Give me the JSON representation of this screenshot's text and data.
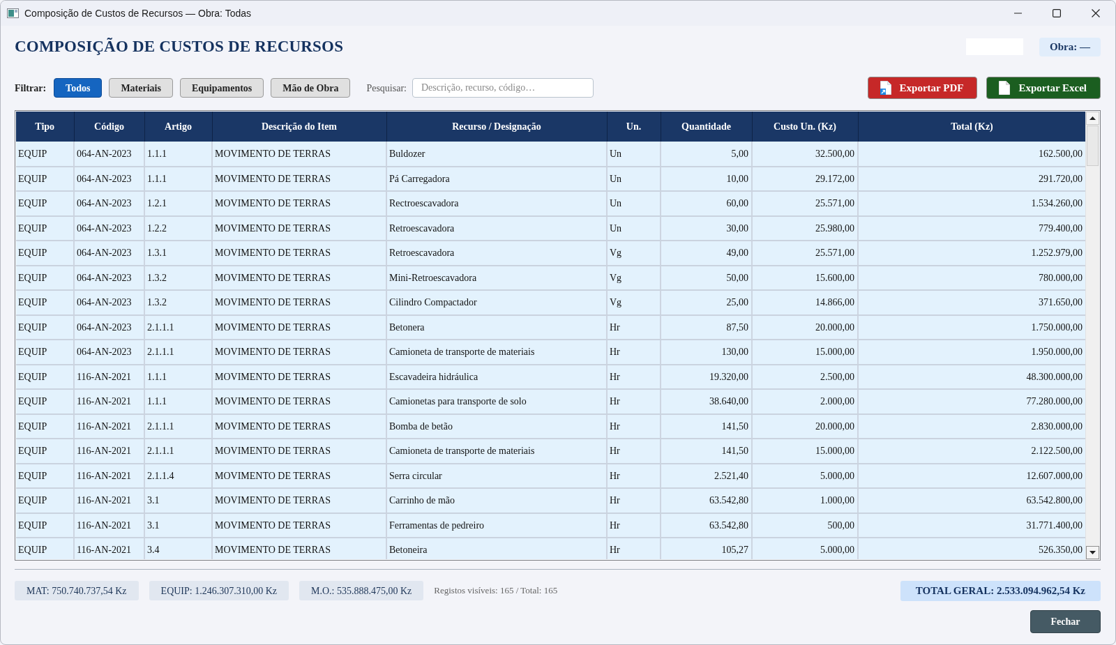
{
  "window": {
    "title": "Composição de Custos de Recursos — Obra: Todas"
  },
  "header": {
    "title": "COMPOSIÇÃO DE CUSTOS DE RECURSOS",
    "obra_label": "Obra: —"
  },
  "filter": {
    "label": "Filtrar:",
    "options": [
      {
        "label": "Todos",
        "selected": true
      },
      {
        "label": "Materiais",
        "selected": false
      },
      {
        "label": "Equipamentos",
        "selected": false
      },
      {
        "label": "Mão de Obra",
        "selected": false
      }
    ],
    "search": {
      "label": "Pesquisar:",
      "placeholder": "Descrição, recurso, código…"
    }
  },
  "export_buttons": [
    {
      "label": "Exportar PDF",
      "kind": "pdf"
    },
    {
      "label": "Exportar Excel",
      "kind": "excel"
    }
  ],
  "table": {
    "columns": [
      {
        "label": "Tipo",
        "kind": "text"
      },
      {
        "label": "Código",
        "kind": "text"
      },
      {
        "label": "Artigo",
        "kind": "text"
      },
      {
        "label": "Descrição do Item",
        "kind": "text"
      },
      {
        "label": "Recurso / Designação",
        "kind": "text"
      },
      {
        "label": "Un.",
        "kind": "text"
      },
      {
        "label": "Quantidade",
        "kind": "number"
      },
      {
        "label": "Custo Un. (Kz)",
        "kind": "number"
      },
      {
        "label": "Total (Kz)",
        "kind": "number"
      }
    ],
    "rows": [
      [
        "EQUIP",
        "064-AN-2023",
        "1.1.1",
        "MOVIMENTO DE TERRAS",
        "Buldozer",
        "Un",
        "5,00",
        "32.500,00",
        "162.500,00"
      ],
      [
        "EQUIP",
        "064-AN-2023",
        "1.1.1",
        "MOVIMENTO DE TERRAS",
        "Pá Carregadora",
        "Un",
        "10,00",
        "29.172,00",
        "291.720,00"
      ],
      [
        "EQUIP",
        "064-AN-2023",
        "1.2.1",
        "MOVIMENTO DE TERRAS",
        "Rectroescavadora",
        "Un",
        "60,00",
        "25.571,00",
        "1.534.260,00"
      ],
      [
        "EQUIP",
        "064-AN-2023",
        "1.2.2",
        "MOVIMENTO DE TERRAS",
        "Retroescavadora",
        "Un",
        "30,00",
        "25.980,00",
        "779.400,00"
      ],
      [
        "EQUIP",
        "064-AN-2023",
        "1.3.1",
        "MOVIMENTO DE TERRAS",
        "Retroescavadora",
        "Vg",
        "49,00",
        "25.571,00",
        "1.252.979,00"
      ],
      [
        "EQUIP",
        "064-AN-2023",
        "1.3.2",
        "MOVIMENTO DE TERRAS",
        "Mini-Retroescavadora",
        "Vg",
        "50,00",
        "15.600,00",
        "780.000,00"
      ],
      [
        "EQUIP",
        "064-AN-2023",
        "1.3.2",
        "MOVIMENTO DE TERRAS",
        "Cilindro Compactador",
        "Vg",
        "25,00",
        "14.866,00",
        "371.650,00"
      ],
      [
        "EQUIP",
        "064-AN-2023",
        "2.1.1.1",
        "MOVIMENTO DE TERRAS",
        "Betonera",
        "Hr",
        "87,50",
        "20.000,00",
        "1.750.000,00"
      ],
      [
        "EQUIP",
        "064-AN-2023",
        "2.1.1.1",
        "MOVIMENTO DE TERRAS",
        "Camioneta de transporte de materiais",
        "Hr",
        "130,00",
        "15.000,00",
        "1.950.000,00"
      ],
      [
        "EQUIP",
        "116-AN-2021",
        "1.1.1",
        "MOVIMENTO DE TERRAS",
        "Escavadeira hidráulica",
        "Hr",
        "19.320,00",
        "2.500,00",
        "48.300.000,00"
      ],
      [
        "EQUIP",
        "116-AN-2021",
        "1.1.1",
        "MOVIMENTO DE TERRAS",
        "Camionetas para transporte de solo",
        "Hr",
        "38.640,00",
        "2.000,00",
        "77.280.000,00"
      ],
      [
        "EQUIP",
        "116-AN-2021",
        "2.1.1.1",
        "MOVIMENTO DE TERRAS",
        "Bomba de betão",
        "Hr",
        "141,50",
        "20.000,00",
        "2.830.000,00"
      ],
      [
        "EQUIP",
        "116-AN-2021",
        "2.1.1.1",
        "MOVIMENTO DE TERRAS",
        "Camioneta de transporte de materiais",
        "Hr",
        "141,50",
        "15.000,00",
        "2.122.500,00"
      ],
      [
        "EQUIP",
        "116-AN-2021",
        "2.1.1.4",
        "MOVIMENTO DE TERRAS",
        "Serra circular",
        "Hr",
        "2.521,40",
        "5.000,00",
        "12.607.000,00"
      ],
      [
        "EQUIP",
        "116-AN-2021",
        "3.1",
        "MOVIMENTO DE TERRAS",
        "Carrinho de mão",
        "Hr",
        "63.542,80",
        "1.000,00",
        "63.542.800,00"
      ],
      [
        "EQUIP",
        "116-AN-2021",
        "3.1",
        "MOVIMENTO DE TERRAS",
        "Ferramentas de pedreiro",
        "Hr",
        "63.542,80",
        "500,00",
        "31.771.400,00"
      ],
      [
        "EQUIP",
        "116-AN-2021",
        "3.4",
        "MOVIMENTO DE TERRAS",
        "Betoneira",
        "Hr",
        "105,27",
        "5.000,00",
        "526.350,00"
      ]
    ]
  },
  "summary": {
    "subtotals": [
      "MAT: 750.740.737,54 Kz",
      "EQUIP: 1.246.307.310,00 Kz",
      "M.O.: 535.888.475,00 Kz"
    ],
    "record_count": "Registos visíveis: 165 / Total: 165",
    "grand_total": "TOTAL GERAL: 2.533.094.962,54 Kz"
  },
  "buttons": [
    "Fechar"
  ]
}
